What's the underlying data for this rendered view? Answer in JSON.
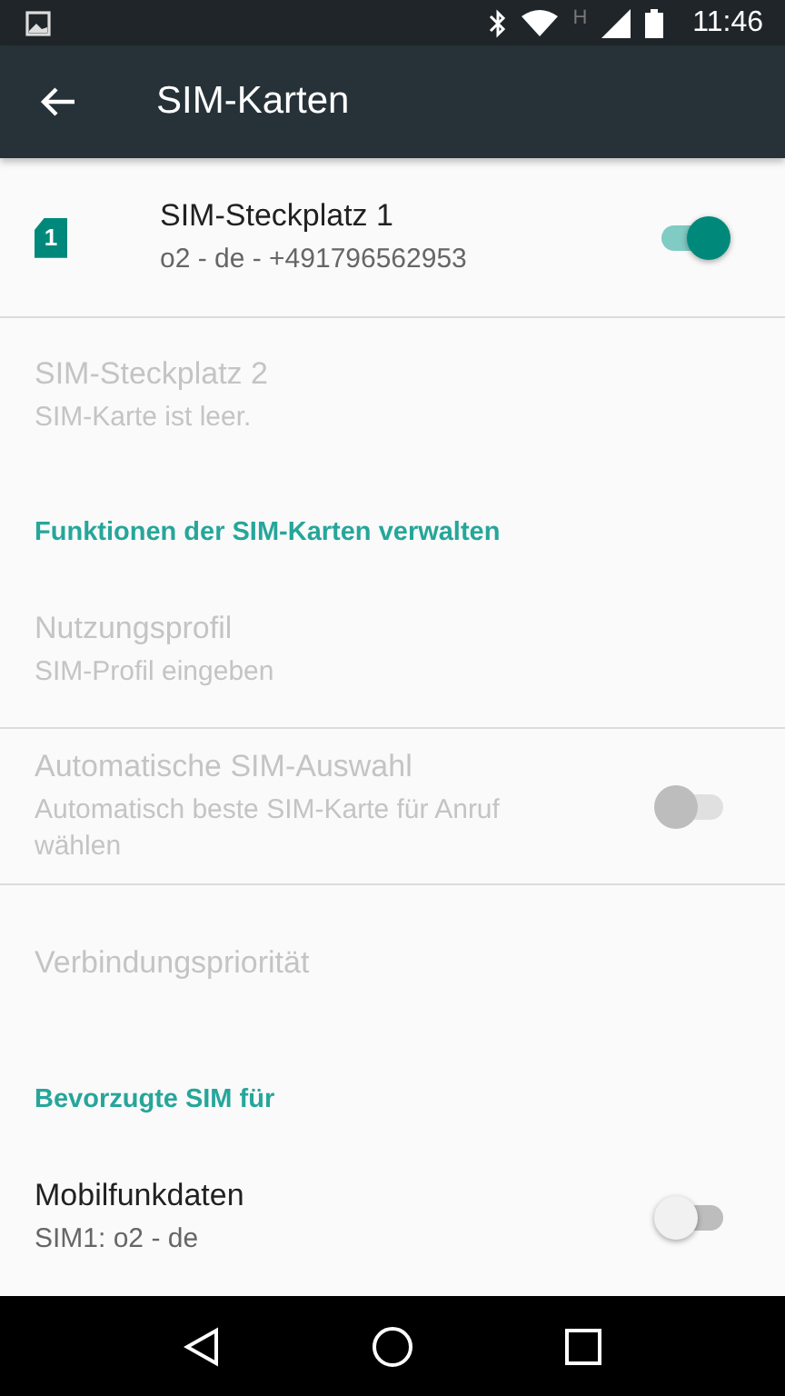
{
  "status_bar": {
    "network_type": "H",
    "time": "11:46"
  },
  "app_bar": {
    "title": "SIM-Karten"
  },
  "items": [
    {
      "kind": "sim",
      "sim_number": "1",
      "title": "SIM-Steckplatz 1",
      "summary": "o2 - de - +491796562953",
      "disabled": false,
      "switch": {
        "on": true
      },
      "divider": true
    },
    {
      "kind": "setting",
      "title": "SIM-Steckplatz 2",
      "summary": "SIM-Karte ist leer.",
      "disabled": true,
      "divider": false
    },
    {
      "kind": "header",
      "title": "Funktionen der SIM-Karten verwalten"
    },
    {
      "kind": "setting",
      "title": "Nutzungsprofil",
      "summary": "SIM-Profil eingeben",
      "disabled": true,
      "divider": true
    },
    {
      "kind": "setting",
      "title": "Automatische SIM-Auswahl",
      "summary": "Automatisch beste SIM-Karte für Anruf wählen",
      "disabled": true,
      "switch": {
        "on": false
      },
      "divider": true
    },
    {
      "kind": "setting",
      "title": "Verbindungspriorität",
      "disabled": true,
      "divider": false
    },
    {
      "kind": "header",
      "title": "Bevorzugte SIM für"
    },
    {
      "kind": "setting",
      "title": "Mobilfunkdaten",
      "summary": "SIM1: o2 - de",
      "disabled": false,
      "switch": {
        "on": false
      },
      "divider": false
    }
  ]
}
